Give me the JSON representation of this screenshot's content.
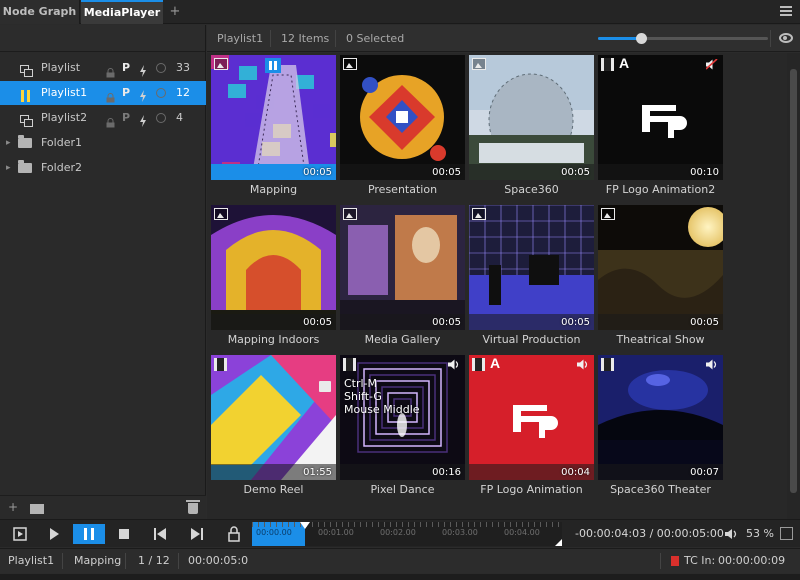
{
  "tabs": [
    {
      "label": "Node Graph",
      "active": false
    },
    {
      "label": "MediaPlayer",
      "active": true
    }
  ],
  "add_tab_label": "+",
  "header": {
    "playlist_name": "Playlist1",
    "item_count": "12 Items",
    "selected_count": "0 Selected",
    "thumbnail_zoom_fraction": 0.25
  },
  "tree": {
    "playlists": [
      {
        "label": "Playlist",
        "p": "P",
        "count": "33",
        "selected": false
      },
      {
        "label": "Playlist1",
        "p": "P",
        "count": "12",
        "selected": true
      },
      {
        "label": "Playlist2",
        "p": "P",
        "count": "4",
        "selected": false
      }
    ],
    "folders": [
      {
        "label": "Folder1"
      },
      {
        "label": "Folder2"
      }
    ]
  },
  "footer": {
    "add_label": "+"
  },
  "items": [
    {
      "label": "Mapping",
      "duration": "00:05",
      "badge": "image",
      "playing": true,
      "colors": [
        "#d2307a",
        "#2cc7d8",
        "#5b2ed1",
        "#f0e44a"
      ]
    },
    {
      "label": "Presentation",
      "duration": "00:05",
      "badge": "image",
      "colors": [
        "#e7a326",
        "#3250c4",
        "#d93a2c",
        "#ffffff"
      ]
    },
    {
      "label": "Space360",
      "duration": "00:05",
      "badge": "image",
      "colors": [
        "#a9b6c3",
        "#5f6d77",
        "#d6dde2",
        "#3b4a3a"
      ]
    },
    {
      "label": "FP Logo Animation2",
      "duration": "00:10",
      "badge": "film",
      "muted": true,
      "colors": [
        "#0a0a0a",
        "#ffffff"
      ]
    },
    {
      "label": "Mapping Indoors",
      "duration": "00:05",
      "badge": "image",
      "colors": [
        "#e4b22a",
        "#8a3fc7",
        "#d64f2c",
        "#1e1237"
      ]
    },
    {
      "label": "Media Gallery",
      "duration": "00:05",
      "badge": "image",
      "colors": [
        "#8a5fb0",
        "#c07a4a",
        "#2c2440",
        "#e4c7a3"
      ]
    },
    {
      "label": "Virtual Production",
      "duration": "00:05",
      "badge": "image",
      "colors": [
        "#4040c8",
        "#1d1d3b",
        "#9a8cff",
        "#0f0f0f"
      ]
    },
    {
      "label": "Theatrical Show",
      "duration": "00:05",
      "badge": "image",
      "colors": [
        "#e6c56a",
        "#2b2214",
        "#0d0b08",
        "#6e5a2b"
      ]
    },
    {
      "label": "Demo Reel",
      "duration": "01:55",
      "badge": "film",
      "note": true,
      "colors": [
        "#e63d82",
        "#2ea8e6",
        "#f2d230",
        "#8b42d9"
      ]
    },
    {
      "label": "Pixel Dance",
      "duration": "00:16",
      "badge": "film",
      "audio": true,
      "tooltip": [
        "Ctrl-M",
        "Shift-G",
        "Mouse Middle"
      ],
      "colors": [
        "#0d0a14",
        "#d3b6ff",
        "#4a2f7a",
        "#ffffff"
      ]
    },
    {
      "label": "FP Logo Animation",
      "duration": "00:04",
      "badge": "film",
      "audio": true,
      "colors": [
        "#d61f2a",
        "#ffffff"
      ]
    },
    {
      "label": "Space360 Theater",
      "duration": "00:07",
      "badge": "film",
      "audio": true,
      "colors": [
        "#1a1f6b",
        "#2e3cb8",
        "#05060f",
        "#6b78ff"
      ]
    }
  ],
  "transport": {
    "timeline_labels": [
      "00:00.00",
      "00:01.00",
      "00:02.00",
      "00:03.00",
      "00:04.00"
    ],
    "timecode": "-00:00:04:03 / 00:00:05:00",
    "volume": "53 %",
    "playhead_fraction": 0.17
  },
  "status": {
    "playlist": "Playlist1",
    "item": "Mapping",
    "position": "1 / 12",
    "time": "00:00:05:0",
    "tc_label": "TC In:",
    "tc_value": "00:00:00:09"
  },
  "accent_color": "#1b8ee8"
}
